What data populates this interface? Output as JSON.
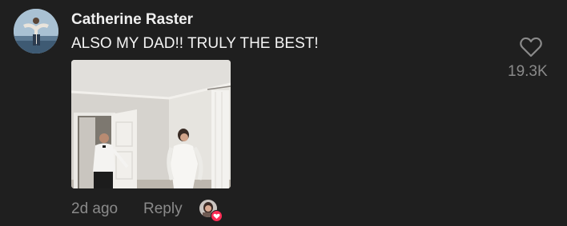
{
  "comment": {
    "username": "Catherine Raster",
    "text": "ALSO MY DAD!! TRULY THE BEST!",
    "timestamp": "2d ago",
    "reply_label": "Reply",
    "like_count": "19.3K",
    "like_icon": "heart-outline-icon",
    "creator_liked_icon": "heart-icon"
  },
  "colors": {
    "background": "#1f1f1f",
    "username": "#efefef",
    "text": "#f4f4f4",
    "muted": "#8a8a8a",
    "accent": "#fe2c55"
  }
}
